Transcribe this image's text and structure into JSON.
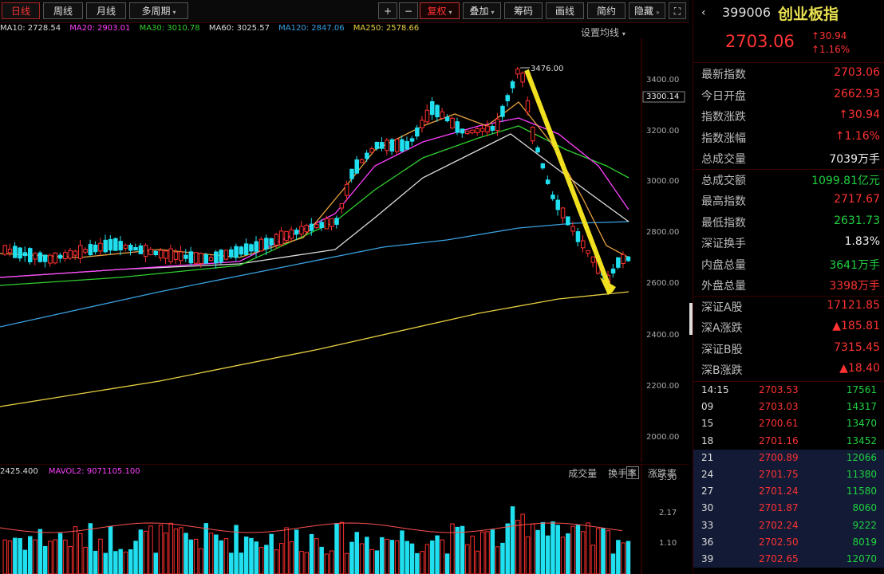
{
  "toolbar": {
    "items": [
      "日线",
      "周线",
      "月线",
      "多周期"
    ],
    "zoom_in": "+",
    "zoom_out": "−",
    "right_items": [
      "复权",
      "叠加",
      "筹码",
      "画线",
      "简约",
      "隐藏"
    ],
    "expand": "⛶"
  },
  "ma_legend": [
    {
      "text": "MA10: 2728.54",
      "color": "#dddddd"
    },
    {
      "text": "MA20: 2903.01",
      "color": "#ff40ff"
    },
    {
      "text": "MA30: 3010.78",
      "color": "#30d030"
    },
    {
      "text": "MA60: 3025.57",
      "color": "#dddddd"
    },
    {
      "text": "MA120: 2847.06",
      "color": "#3aa0e0"
    },
    {
      "text": "MA250: 2578.66",
      "color": "#e8d040"
    }
  ],
  "settings_label": "设置均线",
  "chart": {
    "y_ticks": [
      "3400.00",
      "3300.14",
      "3200.00",
      "3000.00",
      "2800.00",
      "2600.00",
      "2400.00",
      "2200.00",
      "2000.00"
    ],
    "high_label": "3476.00",
    "vol_ticks": [
      "3.30",
      "2.17",
      "1.10"
    ]
  },
  "vol_legend": {
    "a": "2425.400",
    "b": "MAVOL2: 9071105.100"
  },
  "vol_tabs": [
    "成交量",
    "换手率",
    "涨跌率"
  ],
  "vol_close": "×",
  "panel": {
    "code": "399006",
    "name": "创业板指",
    "price": "2703.06",
    "change": "↑30.94",
    "change_pct": "↑1.16%",
    "rows": [
      {
        "label": "最新指数",
        "value": "2703.06",
        "color": "red"
      },
      {
        "label": "今日开盘",
        "value": "2662.93",
        "color": "red"
      },
      {
        "label": "指数涨跌",
        "value": "↑30.94",
        "color": "red"
      },
      {
        "label": "指数涨幅",
        "value": "↑1.16%",
        "color": "red"
      },
      {
        "label": "总成交量",
        "value": "7039万手",
        "color": "white"
      },
      {
        "label": "总成交额",
        "value": "1099.81亿元",
        "color": "green"
      },
      {
        "label": "最高指数",
        "value": "2717.67",
        "color": "red"
      },
      {
        "label": "最低指数",
        "value": "2631.73",
        "color": "green"
      },
      {
        "label": "深证换手",
        "value": "1.83%",
        "color": "white"
      },
      {
        "label": "内盘总量",
        "value": "3641万手",
        "color": "green"
      },
      {
        "label": "外盘总量",
        "value": "3398万手",
        "color": "red"
      },
      {
        "label": "深证A股",
        "value": "17121.85",
        "color": "red"
      },
      {
        "label": "深A涨跌",
        "value": "▲185.81",
        "color": "red"
      },
      {
        "label": "深证B股",
        "value": "7315.45",
        "color": "red"
      },
      {
        "label": "深B涨跌",
        "value": "▲18.40",
        "color": "red"
      }
    ],
    "ticks": [
      {
        "t": "14:15",
        "p": "2703.53",
        "v": "17561"
      },
      {
        "t": "09",
        "p": "2703.03",
        "v": "14317"
      },
      {
        "t": "15",
        "p": "2700.61",
        "v": "13470"
      },
      {
        "t": "18",
        "p": "2701.16",
        "v": "13452"
      },
      {
        "t": "21",
        "p": "2700.89",
        "v": "12066"
      },
      {
        "t": "24",
        "p": "2701.75",
        "v": "11380"
      },
      {
        "t": "27",
        "p": "2701.24",
        "v": "11580"
      },
      {
        "t": "30",
        "p": "2701.87",
        "v": "8060"
      },
      {
        "t": "33",
        "p": "2702.24",
        "v": "9222"
      },
      {
        "t": "36",
        "p": "2702.50",
        "v": "8019"
      },
      {
        "t": "39",
        "p": "2702.65",
        "v": "12070"
      }
    ]
  }
}
